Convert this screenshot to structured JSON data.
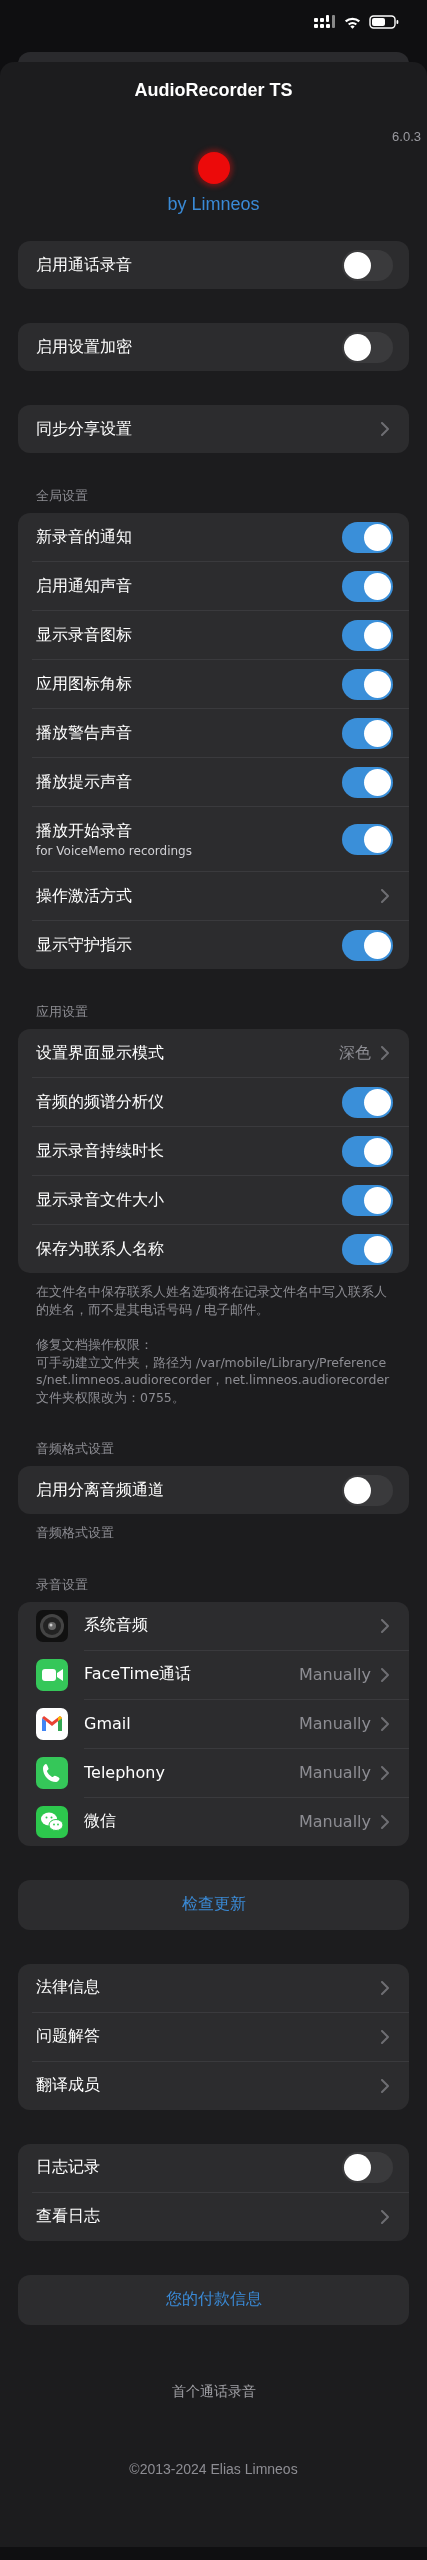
{
  "header": {
    "title": "AudioRecorder TS",
    "version": "6.0.3",
    "author": "by Limneos"
  },
  "sections": [
    {
      "rows": [
        {
          "kind": "toggle",
          "label": "启用通话录音",
          "on": false
        }
      ]
    },
    {
      "rows": [
        {
          "kind": "toggle",
          "label": "启用设置加密",
          "on": false
        }
      ]
    },
    {
      "rows": [
        {
          "kind": "link",
          "label": "同步分享设置"
        }
      ]
    },
    {
      "header": "全局设置",
      "rows": [
        {
          "kind": "toggle",
          "label": "新录音的通知",
          "on": true
        },
        {
          "kind": "toggle",
          "label": "启用通知声音",
          "on": true
        },
        {
          "kind": "toggle",
          "label": "显示录音图标",
          "on": true
        },
        {
          "kind": "toggle",
          "label": "应用图标角标",
          "on": true
        },
        {
          "kind": "toggle",
          "label": "播放警告声音",
          "on": true
        },
        {
          "kind": "toggle",
          "label": "播放提示声音",
          "on": true
        },
        {
          "kind": "toggle",
          "label": "播放开始录音",
          "subtitle": "for VoiceMemo recordings",
          "on": true
        },
        {
          "kind": "link",
          "label": "操作激活方式"
        },
        {
          "kind": "toggle",
          "label": "显示守护指示",
          "on": true
        }
      ]
    },
    {
      "header": "应用设置",
      "rows": [
        {
          "kind": "link",
          "label": "设置界面显示模式",
          "value": "深色"
        },
        {
          "kind": "toggle",
          "label": "音频的频谱分析仪",
          "on": true
        },
        {
          "kind": "toggle",
          "label": "显示录音持续时长",
          "on": true
        },
        {
          "kind": "toggle",
          "label": "显示录音文件大小",
          "on": true
        },
        {
          "kind": "toggle",
          "label": "保存为联系人名称",
          "on": true
        }
      ],
      "footer": [
        [
          "在文件名中保存联系人姓名选项将在记录文件名中写入联系人的姓名，而不是其电话号码 / 电子邮件。"
        ],
        [
          "修复文档操作权限：",
          "可手动建立文件夹，路径为 /var/mobile/Library/Preferences/net.limneos.audiorecorder，net.limneos.audiorecorder 文件夹权限改为：0755。"
        ]
      ]
    },
    {
      "header": "音频格式设置",
      "rows": [
        {
          "kind": "toggle",
          "label": "启用分离音频通道",
          "on": false
        }
      ],
      "footer": [
        [
          "音频格式设置"
        ]
      ]
    },
    {
      "header": "录音设置",
      "rows": [
        {
          "kind": "app",
          "label": "系统音频"
        },
        {
          "kind": "app",
          "label": "FaceTime通话",
          "value": "Manually"
        },
        {
          "kind": "app",
          "label": "Gmail",
          "value": "Manually"
        },
        {
          "kind": "app",
          "label": "Telephony",
          "value": "Manually"
        },
        {
          "kind": "app",
          "label": "微信",
          "value": "Manually"
        }
      ]
    },
    {
      "rows": [
        {
          "kind": "button",
          "label": "检查更新"
        }
      ]
    },
    {
      "rows": [
        {
          "kind": "link",
          "label": "法律信息"
        },
        {
          "kind": "link",
          "label": "问题解答"
        },
        {
          "kind": "link",
          "label": "翻译成员"
        }
      ]
    },
    {
      "rows": [
        {
          "kind": "toggle",
          "label": "日志记录",
          "on": false
        },
        {
          "kind": "link",
          "label": "查看日志"
        }
      ]
    },
    {
      "rows": [
        {
          "kind": "button",
          "label": "您的付款信息"
        }
      ]
    }
  ],
  "footer": {
    "note": "首个通话录音",
    "copyright": "©2013-2024 Elias Limneos"
  }
}
